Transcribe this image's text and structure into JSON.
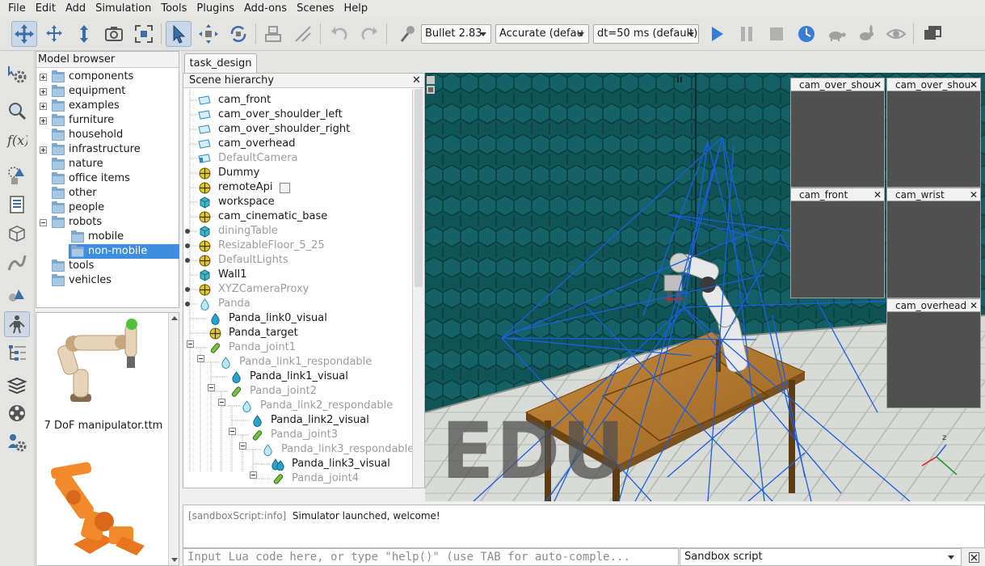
{
  "menu": [
    "File",
    "Edit",
    "Add",
    "Simulation",
    "Tools",
    "Plugins",
    "Add-ons",
    "Scenes",
    "Help"
  ],
  "toolbar": {
    "engine": "Bullet 2.83",
    "accuracy": "Accurate (defau",
    "timestep": "dt=50 ms (default)"
  },
  "model_browser": {
    "title": "Model browser",
    "items": [
      {
        "label": "components",
        "expander": "plus"
      },
      {
        "label": "equipment",
        "expander": "plus"
      },
      {
        "label": "examples",
        "expander": "plus"
      },
      {
        "label": "furniture",
        "expander": "plus"
      },
      {
        "label": "household",
        "expander": "none"
      },
      {
        "label": "infrastructure",
        "expander": "plus"
      },
      {
        "label": "nature",
        "expander": "none"
      },
      {
        "label": "office items",
        "expander": "none"
      },
      {
        "label": "other",
        "expander": "none"
      },
      {
        "label": "people",
        "expander": "none"
      },
      {
        "label": "robots",
        "expander": "minus"
      },
      {
        "label": "mobile",
        "expander": "none"
      },
      {
        "label": "non-mobile",
        "expander": "none"
      },
      {
        "label": "tools",
        "expander": "none"
      },
      {
        "label": "vehicles",
        "expander": "none"
      }
    ],
    "selected": "non-mobile"
  },
  "thumbnails": [
    {
      "label": "7 DoF manipulator.ttm"
    }
  ],
  "tab": {
    "label": "task_design"
  },
  "scene_hierarchy": {
    "title": "Scene hierarchy",
    "items": [
      {
        "label": "cam_front",
        "icon": "camera"
      },
      {
        "label": "cam_over_shoulder_left",
        "icon": "camera"
      },
      {
        "label": "cam_over_shoulder_right",
        "icon": "camera"
      },
      {
        "label": "cam_overhead",
        "icon": "camera"
      },
      {
        "label": "DefaultCamera",
        "icon": "camera"
      },
      {
        "label": "Dummy",
        "icon": "dummy"
      },
      {
        "label": "remoteApi",
        "icon": "dummy"
      },
      {
        "label": "workspace",
        "icon": "shape"
      },
      {
        "label": "cam_cinematic_base",
        "icon": "dummy"
      },
      {
        "label": "diningTable",
        "icon": "shape"
      },
      {
        "label": "ResizableFloor_5_25",
        "icon": "dummy"
      },
      {
        "label": "DefaultLights",
        "icon": "dummy"
      },
      {
        "label": "Wall1",
        "icon": "shape"
      },
      {
        "label": "XYZCameraProxy",
        "icon": "dummy"
      },
      {
        "label": "Panda",
        "icon": "drop"
      },
      {
        "label": "Panda_link0_visual",
        "icon": "drop"
      },
      {
        "label": "Panda_target",
        "icon": "dummy"
      },
      {
        "label": "Panda_joint1",
        "icon": "joint"
      },
      {
        "label": "Panda_link1_respondable",
        "icon": "drop"
      },
      {
        "label": "Panda_link1_visual",
        "icon": "drop"
      },
      {
        "label": "Panda_joint2",
        "icon": "joint"
      },
      {
        "label": "Panda_link2_respondable",
        "icon": "drop"
      },
      {
        "label": "Panda_link2_visual",
        "icon": "drop"
      },
      {
        "label": "Panda_joint3",
        "icon": "joint"
      },
      {
        "label": "Panda_link3_respondable",
        "icon": "drop"
      },
      {
        "label": "Panda_link3_visual",
        "icon": "drops"
      },
      {
        "label": "Panda_joint4",
        "icon": "joint"
      }
    ]
  },
  "floating_views": [
    {
      "title": "cam_over_shou"
    },
    {
      "title": "cam_over_shou"
    },
    {
      "title": "cam_front"
    },
    {
      "title": "cam_wrist"
    },
    {
      "title": "cam_overhead"
    }
  ],
  "viewport": {
    "watermark": "EDU",
    "axis_z": "z"
  },
  "console": {
    "tag": "[sandboxScript:info]",
    "message": "Simulator launched, welcome!",
    "input_placeholder": "Input Lua code here, or type \"help()\" (use TAB for auto-comple...",
    "script_selector": "Sandbox script"
  },
  "colors": {
    "selection": "#3d8ee0",
    "viewport_bg": "#0e4d4f",
    "folder": "#7fa8cc"
  }
}
